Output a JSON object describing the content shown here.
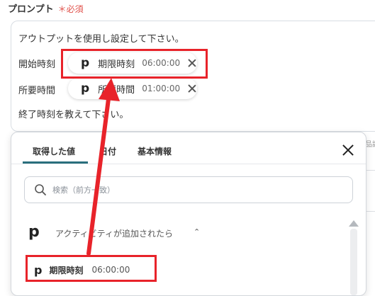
{
  "prompt": {
    "label": "プロンプト",
    "required": "＊必須",
    "line1": "アウトプットを使用し設定して下さい。",
    "start_label": "開始時刻",
    "duration_label": "所要時間",
    "line4": "終了時刻を教えて下さい。",
    "chips": [
      {
        "logo": "p",
        "label": "期限時刻",
        "time": "06:00:00"
      },
      {
        "logo": "p",
        "label": "所要時間",
        "time": "01:00:00"
      }
    ]
  },
  "panel": {
    "tabs": [
      "取得した値",
      "日付",
      "基本情報"
    ],
    "search_placeholder": "検索（前方一致）",
    "section": {
      "logo": "p",
      "title": "アクティビティが追加されたら",
      "chevron": "⌃"
    },
    "result": {
      "logo": "p",
      "label": "期限時刻",
      "time": "06:00:00"
    },
    "right_clipped_text": "品説"
  },
  "colors": {
    "accent": "#2a6f7d",
    "required": "#e0504a",
    "highlight": "#e8232a"
  }
}
